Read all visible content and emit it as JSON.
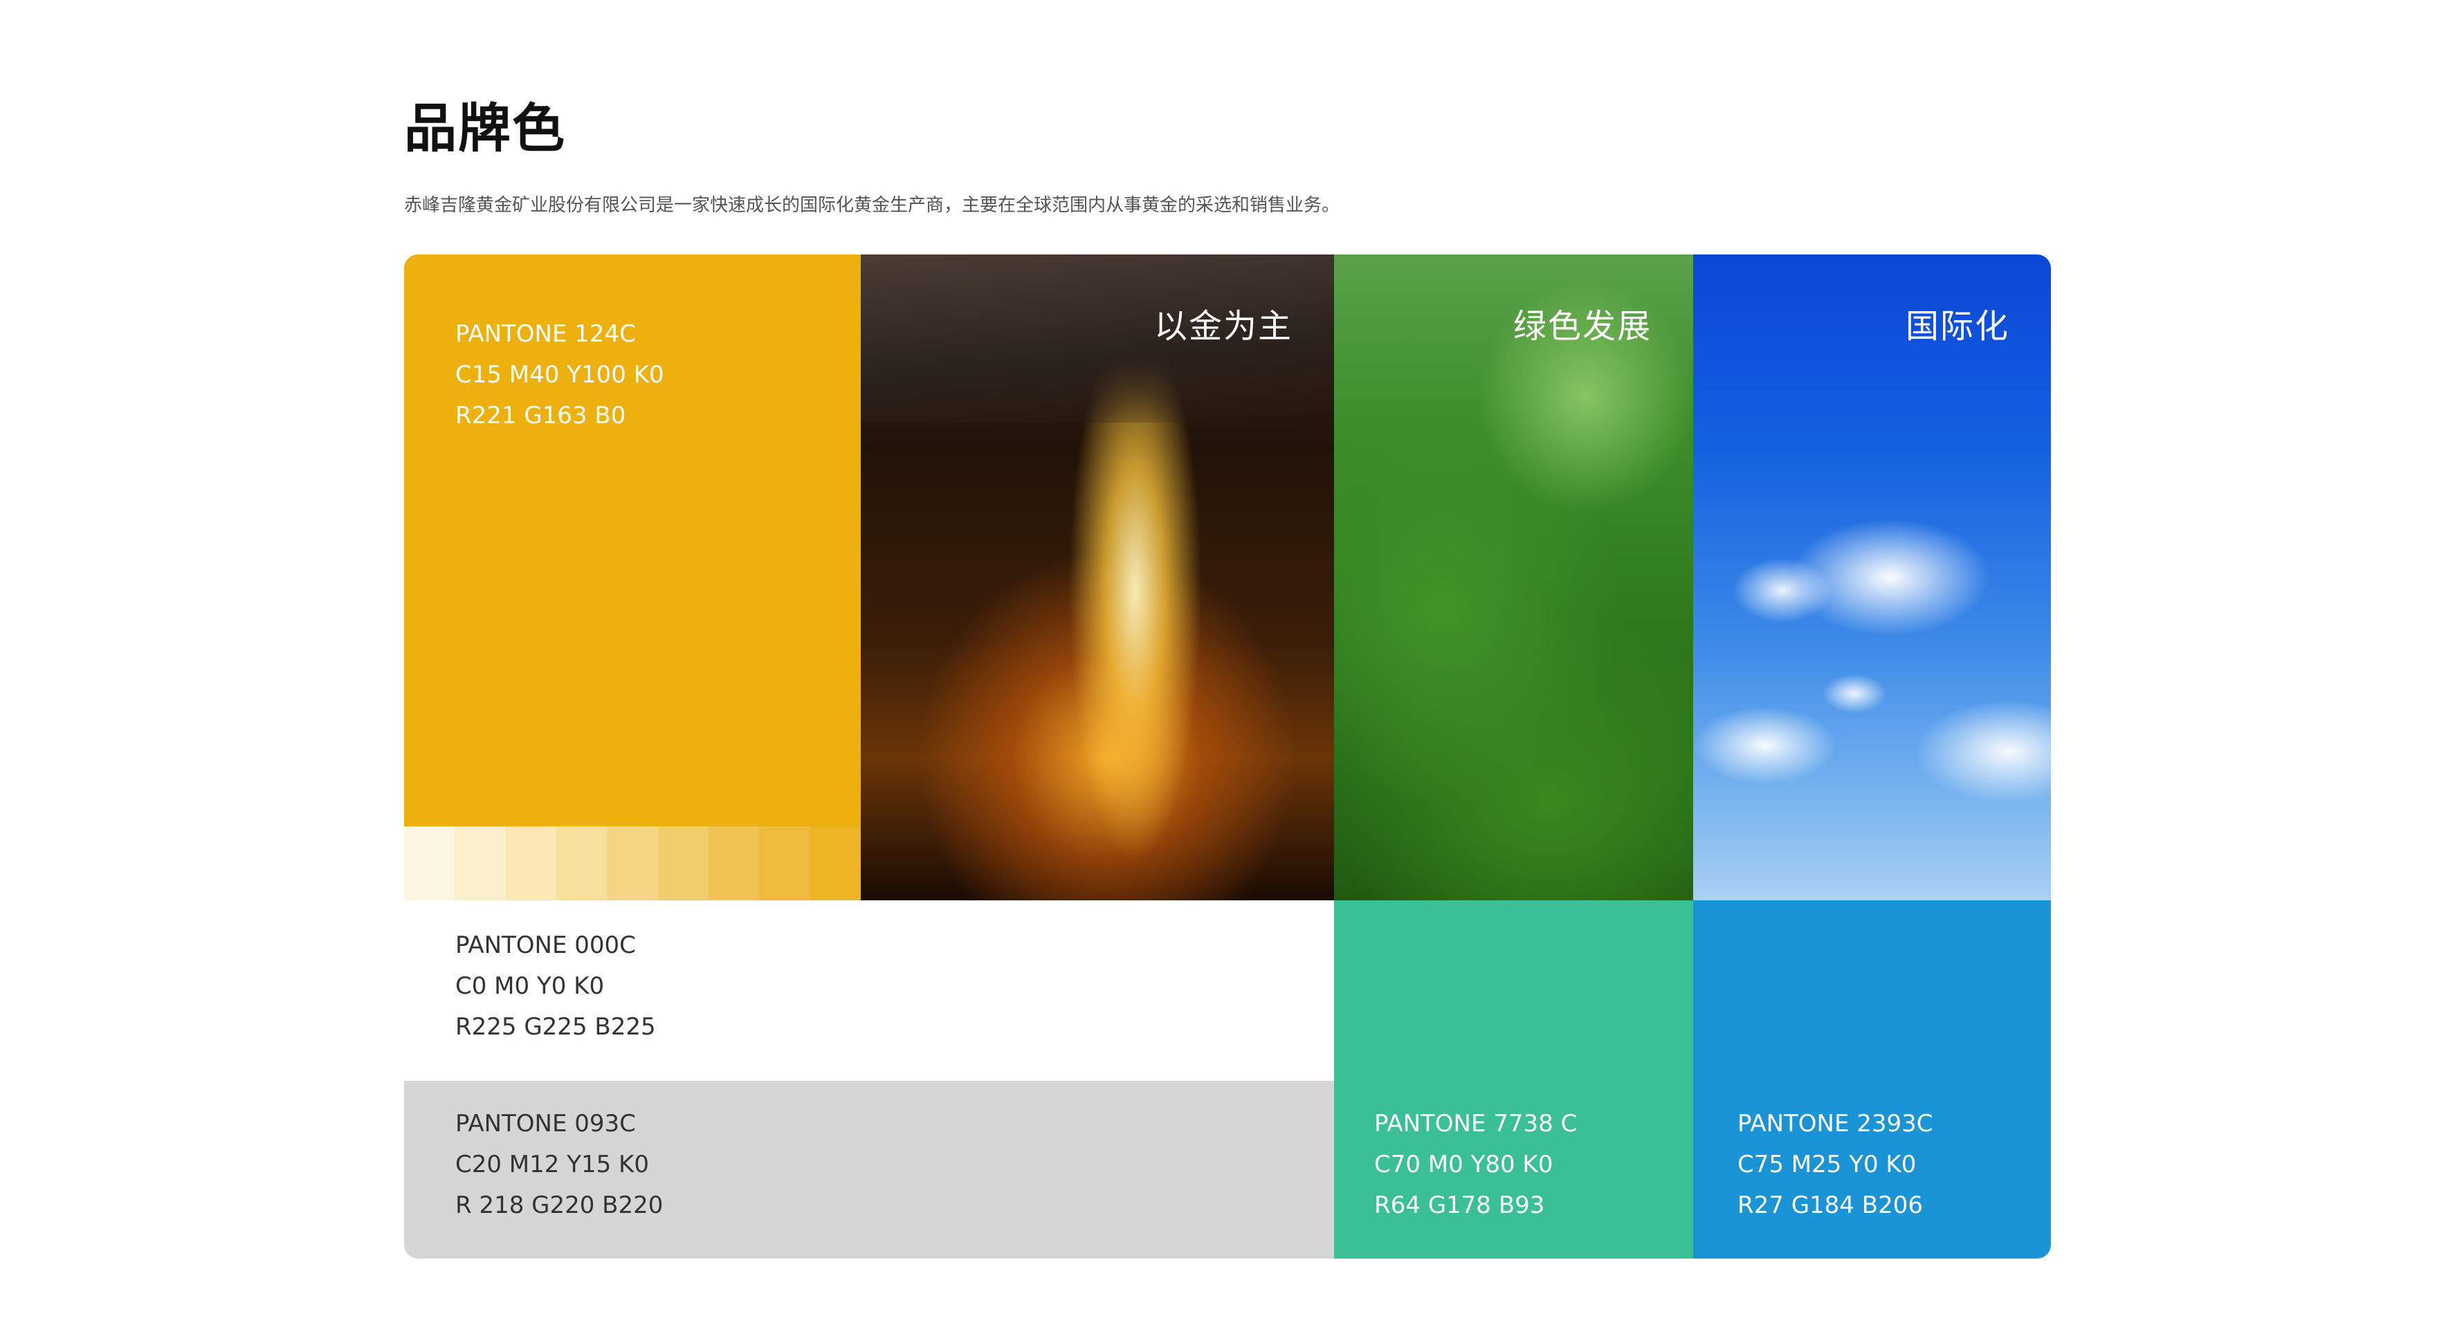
{
  "page": {
    "title": "品牌色",
    "subtitle": "赤峰吉隆黄金矿业股份有限公司是一家快速成长的国际化黄金生产商，主要在全球范围内从事黄金的采选和销售业务。"
  },
  "swatches": {
    "gold": {
      "pantone": "PANTONE 124C",
      "cmyk": "C15 M40 Y100 K0",
      "rgb": "R221 G163 B0",
      "color": "#edb00e",
      "tints": [
        "#fdf6e3",
        "#fbefcc",
        "#f9e7b4",
        "#f7df9c",
        "#f4d684",
        "#f2cd6c",
        "#f0c454",
        "#eebb3c",
        "#edb425"
      ]
    },
    "white": {
      "pantone": "PANTONE 000C",
      "cmyk": "C0 M0 Y0 K0",
      "rgb": "R225 G225 B225",
      "color": "#ffffff"
    },
    "grey": {
      "pantone": "PANTONE 093C",
      "cmyk": "C20 M12 Y15 K0",
      "rgb": "R 218 G220 B220",
      "color": "#d6d6d6"
    },
    "teal": {
      "pantone": "PANTONE 7738 C",
      "cmyk": "C70 M0 Y80 K0",
      "rgb": "R64 G178 B93",
      "color": "#3bbf94"
    },
    "blue": {
      "pantone": "PANTONE 2393C",
      "cmyk": "C75 M25 Y0 K0",
      "rgb": "R27 G184 B206",
      "color": "#1a94d6"
    }
  },
  "images": {
    "metal": {
      "label": "以金为主"
    },
    "green": {
      "label": "绿色发展"
    },
    "sky": {
      "label": "国际化"
    }
  }
}
